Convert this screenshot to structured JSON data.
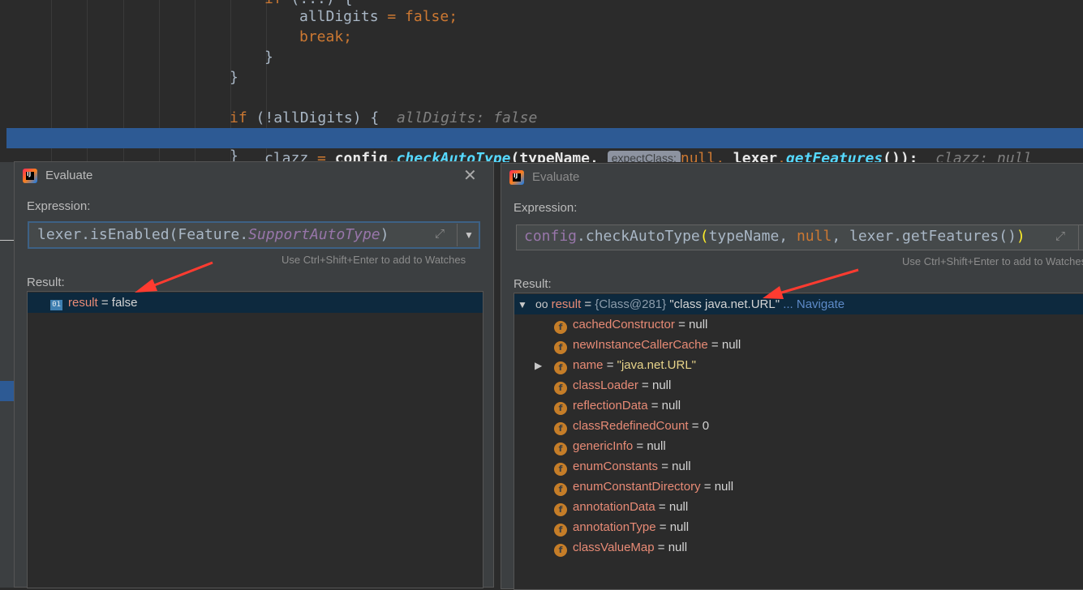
{
  "editor": {
    "lines": [
      {
        "id": "line1",
        "text": "allDigits = false;"
      },
      {
        "id": "line2",
        "text": "break;"
      },
      {
        "id": "line3",
        "text": "}"
      },
      {
        "id": "line4",
        "text": "}"
      },
      {
        "id": "line5",
        "if_kw": "if",
        "cond": "(!allDigits) {",
        "hint": "allDigits: false"
      },
      {
        "id": "line6",
        "lhs": "clazz",
        "eq": "=",
        "obj": "config",
        "method": "checkAutoType",
        "arg1": "(typeName,",
        "param_hint": "expectClass:",
        "arg2": "null,",
        "lexer": "lexer",
        "method2": "getFeatures",
        "tail": "());",
        "hint": "clazz: null"
      },
      {
        "id": "line7",
        "text": "}"
      }
    ]
  },
  "left_dialog": {
    "title": "Evaluate",
    "expression_label": "Expression:",
    "expression_value_plain": "lexer.isEnabled(Feature.",
    "expression_value_italic": "SupportAutoType",
    "expression_value_close": ")",
    "watch_hint": "Use Ctrl+Shift+Enter to add to Watches",
    "result_label": "Result:",
    "result": {
      "name": "result",
      "eq": " = ",
      "value": "false"
    }
  },
  "right_dialog": {
    "title": "Evaluate",
    "expression_label": "Expression:",
    "expression_value": "config.checkAutoType(typeName, null, lexer.getFeatures())",
    "watch_hint": "Use Ctrl+Shift+Enter to add to Watches",
    "result_label": "Result:",
    "result": {
      "name": "result",
      "eq": " = ",
      "type": "{Class@281}",
      "value": "\"class java.net.URL\"",
      "nav": "... Navigate"
    },
    "fields": [
      {
        "name": "cachedConstructor",
        "value": "null",
        "expandable": false
      },
      {
        "name": "newInstanceCallerCache",
        "value": "null",
        "expandable": false
      },
      {
        "name": "name",
        "value": "\"java.net.URL\"",
        "expandable": true
      },
      {
        "name": "classLoader",
        "value": "null",
        "expandable": false
      },
      {
        "name": "reflectionData",
        "value": "null",
        "expandable": false
      },
      {
        "name": "classRedefinedCount",
        "value": "0",
        "expandable": false
      },
      {
        "name": "genericInfo",
        "value": "null",
        "expandable": false
      },
      {
        "name": "enumConstants",
        "value": "null",
        "expandable": false
      },
      {
        "name": "enumConstantDirectory",
        "value": "null",
        "expandable": false
      },
      {
        "name": "annotationData",
        "value": "null",
        "expandable": false
      },
      {
        "name": "annotationType",
        "value": "null",
        "expandable": false
      },
      {
        "name": "classValueMap",
        "value": "null",
        "expandable": false
      }
    ]
  },
  "colors": {
    "editor_bg": "#2b2b2b",
    "dialog_bg": "#3c3f41",
    "highlight_line": "#2d5a94",
    "annotation_arrow": "#ff3b30",
    "field_name": "#e88b76"
  },
  "icons": [
    "intellij-logo-icon",
    "close-icon",
    "expand-icon",
    "dropdown-arrow-icon",
    "primitive-value-icon",
    "watch-glasses-icon",
    "field-icon",
    "expand-triangle-icon"
  ]
}
